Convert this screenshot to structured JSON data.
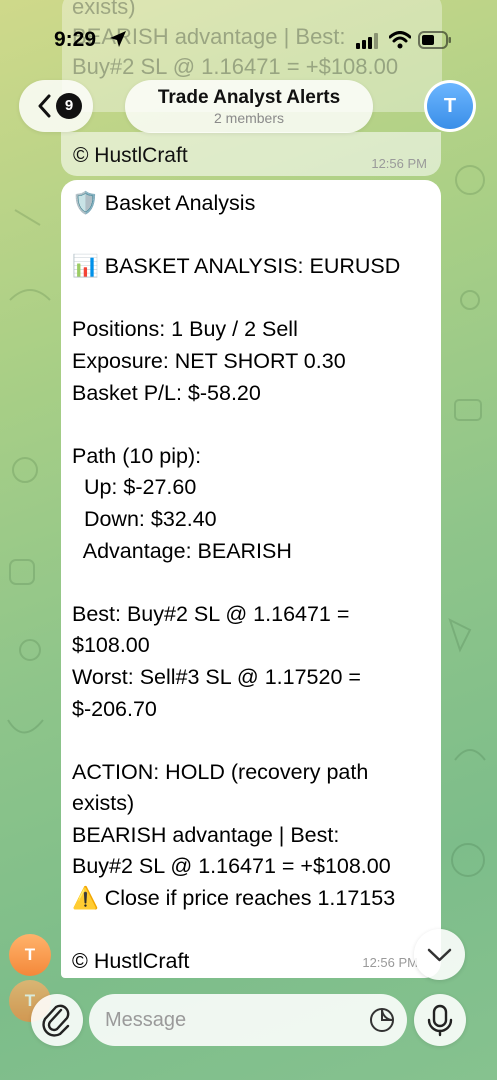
{
  "status_bar": {
    "time": "9:29"
  },
  "header": {
    "back_badge": "9",
    "title": "Trade Analyst Alerts",
    "subtitle": "2 members",
    "avatar_letter": "T"
  },
  "previous_message": {
    "text": "© HustlCraft",
    "time": "12:56 PM",
    "ghost_lines": [
      "exists)",
      "BEARISH advantage | Best:",
      "Buy#2 SL @ 1.16471 = +$108.00"
    ]
  },
  "message": {
    "lines": [
      "🛡️ Basket Analysis",
      "",
      "📊 BASKET ANALYSIS: EURUSD",
      "",
      "Positions: 1 Buy / 2 Sell",
      "Exposure: NET SHORT 0.30",
      "Basket P/L: $-58.20",
      "",
      "Path (10 pip):",
      "  Up: $-27.60",
      "  Down: $32.40",
      "  Advantage: BEARISH",
      "",
      "Best: Buy#2 SL @ 1.16471 =",
      "$108.00",
      "Worst: Sell#3 SL @ 1.17520 =",
      "$-206.70",
      "",
      "ACTION: HOLD (recovery path",
      "exists)",
      "BEARISH advantage | Best:",
      "Buy#2 SL @ 1.16471 = +$108.00",
      "⚠️ Close if price reaches 1.17153",
      "",
      "© HustlCraft"
    ],
    "time": "12:56 PM",
    "sender_avatar_letter": "T"
  },
  "composer": {
    "placeholder": "Message"
  },
  "icons": {
    "back": "chevron-left-icon",
    "attach": "paperclip-icon",
    "sticker": "sticker-icon",
    "mic": "microphone-icon",
    "scroll_down": "chevron-down-icon"
  }
}
